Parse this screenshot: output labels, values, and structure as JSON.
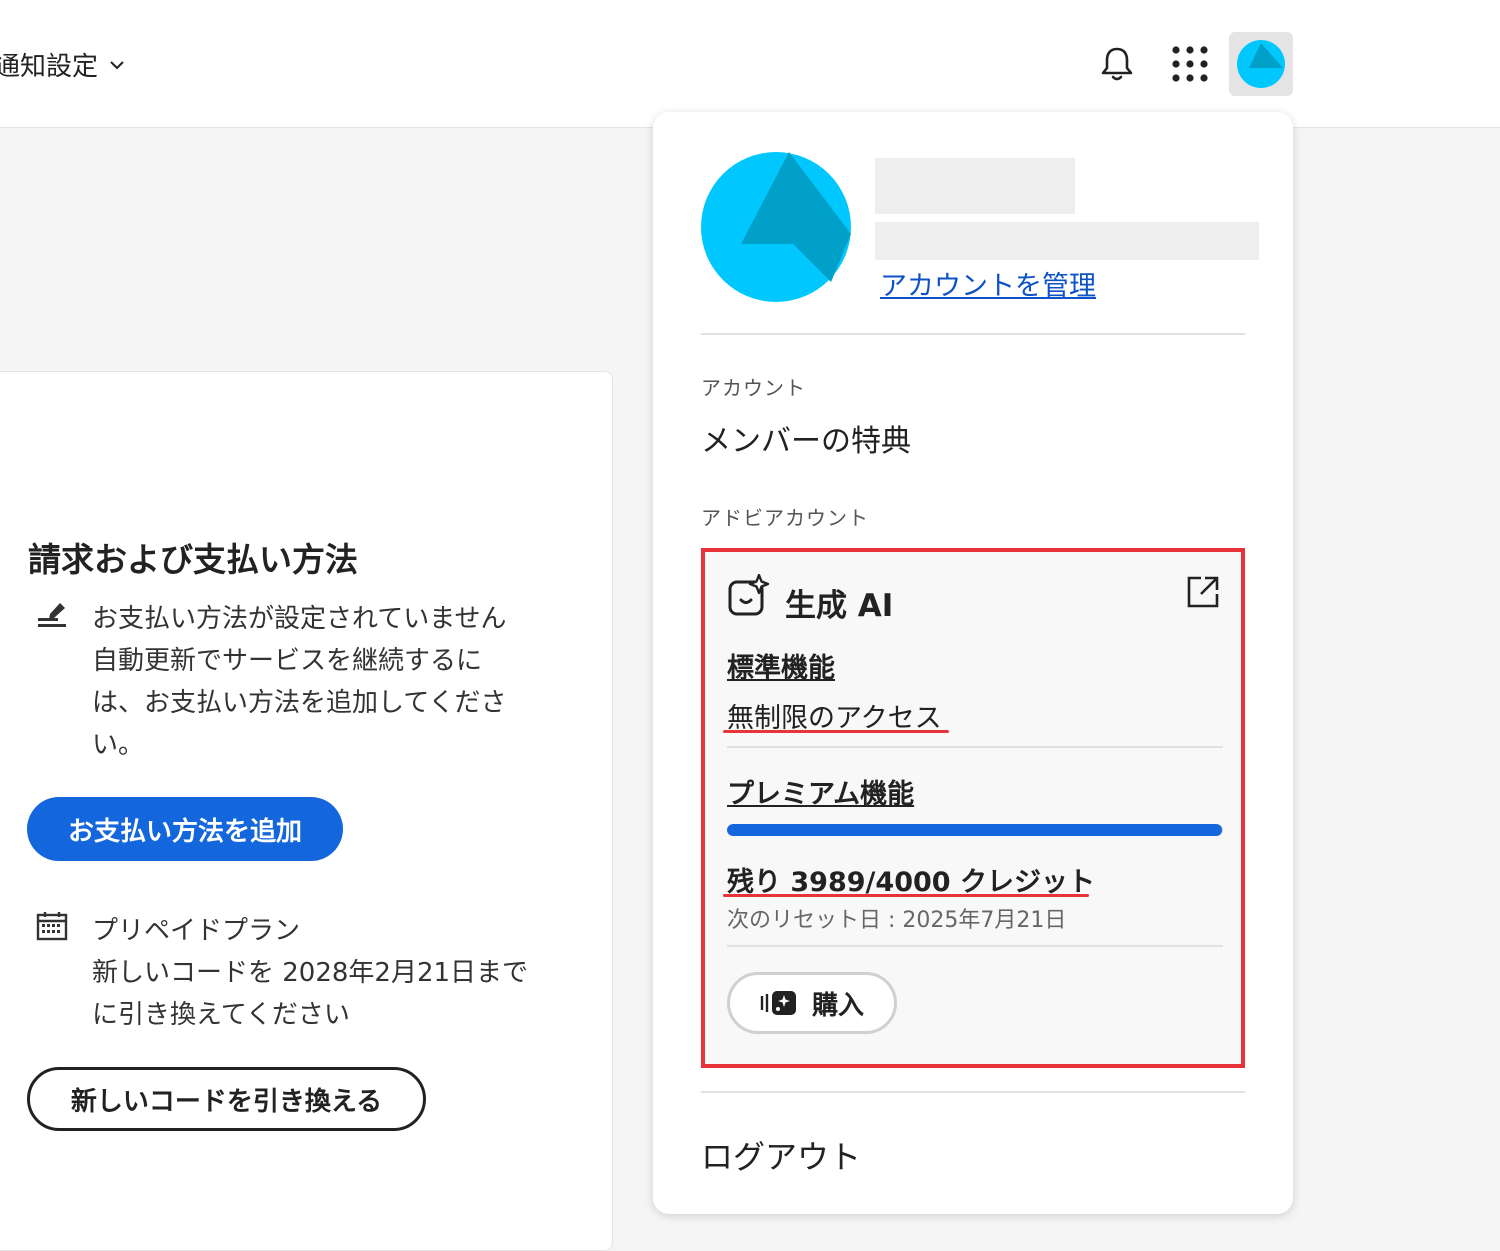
{
  "header": {
    "notification_settings_label": "通知設定"
  },
  "billing": {
    "title": "請求および支払い方法",
    "payment_lines": [
      "お支払い方法が設定されていません",
      "自動更新でサービスを継続するに",
      "は、お支払い方法を追加してくださ",
      "い。"
    ],
    "add_payment_button": "お支払い方法を追加",
    "prepaid_lines": [
      "プリペイドプラン",
      "新しいコードを 2028年2月21日まで",
      "に引き換えてください"
    ],
    "redeem_button": "新しいコードを引き換える"
  },
  "account_panel": {
    "manage_account_link": "アカウントを管理",
    "section_account_label": "アカウント",
    "member_benefits": "メンバーの特典",
    "section_adobe_account_label": "アドビアカウント",
    "generative_ai": {
      "title": "生成 AI",
      "standard_heading": "標準機能",
      "standard_value": "無制限のアクセス",
      "premium_heading": "プレミアム機能",
      "credits_used_fraction": 0.99725,
      "credits_text": "残り 3989/4000 クレジット",
      "reset_text": "次のリセット日 : 2025年7月21日",
      "buy_button": "購入"
    },
    "logout": "ログアウト"
  },
  "colors": {
    "accent_blue": "#1466dc",
    "highlight_red": "#e8333a",
    "avatar_cyan": "#00c8ff",
    "avatar_dark": "#00a0c8"
  }
}
